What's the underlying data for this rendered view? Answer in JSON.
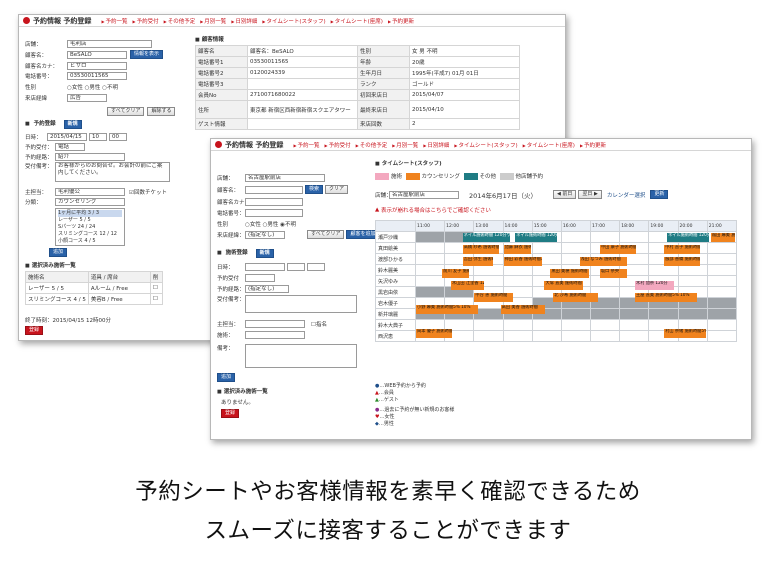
{
  "back": {
    "title": "予約情報 予約登録",
    "nav": [
      "予約一覧",
      "予約受付",
      "その他予定",
      "月別一覧",
      "日別詳細",
      "タイムシート(スタッフ)",
      "タイムシート(座席)",
      "予約更新"
    ],
    "search_section": "お客様検索",
    "member_label": "店舗：",
    "member_value": "毛利店",
    "name_label": "顧客名：",
    "name_value": "BeSALO",
    "kana_label": "顧客名カナ：",
    "kana_value": "ビサロ",
    "tel_label": "電話番号：",
    "tel_value": "03530011565",
    "gender_label": "性別",
    "gender_options": [
      "女性",
      "男性",
      "不明"
    ],
    "source_label": "来店経緯",
    "source_value": "広告",
    "clear_btn": "すべてクリア",
    "search_btn": "情報を表示",
    "cancel_btn": "解除する",
    "reserve_section": "予約登録",
    "new_btn": "新規",
    "date_label": "日時：",
    "date_value": "2015/04/15",
    "hour_value": "10",
    "min_value": "00",
    "status_label": "予約受付：",
    "status_value": "電話",
    "route_label": "予約経路：",
    "route_value": "紹介",
    "memo_label": "受付備考：",
    "memo_value": "お客様からのお問合せ。お会計の前にご案内してください。",
    "staff_label": "主担当：",
    "staff_value": "毛利優公",
    "ticket_label": "回数チケット",
    "menu_label": "分類：",
    "menu_value": "カウンセリング",
    "menu_list": [
      "1ヶ月に平均 3 / 3",
      "レーザー 5 / 5",
      "Sパーツ 24 / 24",
      "スリミングコース 12 / 12",
      "小顔コース 4 / 5"
    ],
    "add_btn": "追加",
    "selected_section": "選択済み施術一覧",
    "selected_head": [
      "施術名",
      "道具 / 席台",
      "削"
    ],
    "selected_rows": [
      {
        "name": "レーザー 5 / 5",
        "tool": "Aルーム",
        "seat": "Free"
      },
      {
        "name": "スリミングコース 4 / 5",
        "tool": "美容B",
        "seat": "Free"
      }
    ],
    "updated": "終了時刻：2015/04/15 12時00分",
    "register_btn": "登録",
    "info_section": "顧客情報",
    "info_rows": [
      {
        "k": "顧客名",
        "v": "顧客名：BeSALO",
        "k2": "性別",
        "v2": "女  男  不明"
      },
      {
        "k": "電話番号1",
        "v": "03530011565",
        "k2": "年齢",
        "v2": "20歳"
      },
      {
        "k": "電話番号2",
        "v": "0120024339",
        "k2": "生年月日",
        "v2": "1995年(平成7)  01月  01日"
      },
      {
        "k": "電話番号3",
        "v": "",
        "k2": "ランク",
        "v2": "ゴールド"
      },
      {
        "k": "会員No",
        "v": "2710071680022",
        "k2": "初回来店日",
        "v2": "2015/04/07"
      },
      {
        "k": "住所",
        "v": "東京都  新宿区西新宿新宿スクエアタワー",
        "k2": "最終来店日",
        "v2": "2015/04/10"
      },
      {
        "k": "ゲスト情報",
        "v": "",
        "k2": "来店回数",
        "v2": "2"
      }
    ]
  },
  "front": {
    "title": "予約情報 予約登録",
    "nav": [
      "予約一覧",
      "予約受付",
      "その他予定",
      "月別一覧",
      "日別詳細",
      "タイムシート(スタッフ)",
      "タイムシート(座席)",
      "予約更新"
    ],
    "store_label": "店舗：",
    "store_value": "名古屋駅前店",
    "name_label": "顧客名：",
    "kana_label": "顧客名カナ：",
    "tel_label": "電話番号：",
    "gender_label": "性別",
    "gender_options": [
      "女性",
      "男性",
      "不明"
    ],
    "source_label": "来店経緯：",
    "source_value": "(指定なし)",
    "search_btn": "検索",
    "clear_btn": "クリア",
    "all_clear_btn": "すべてクリア",
    "new_customer_btn": "顧客を追加",
    "reserve_section": "施術登録",
    "new_btn": "新規",
    "date_label": "日時：",
    "menu_section_label": "予約受付",
    "route_label": "予約経路：",
    "route_value": "(指定なし)",
    "memo_label": "受付備考：",
    "staff_label": "主担当：",
    "assign_label": "指名",
    "menu_label": "施術：",
    "note_label": "備考：",
    "add_btn": "追加",
    "selected_section": "選択済み施術一覧",
    "selected_empty": "ありません。",
    "register_btn": "登録",
    "timesheet_section": "タイムシート(スタッフ)",
    "legend": [
      {
        "label": "施術",
        "color": "#f3a8bf"
      },
      {
        "label": "カウンセリング",
        "color": "#f0831e"
      },
      {
        "label": "その他",
        "color": "#1f7c84"
      },
      {
        "label": "他店舗予約",
        "color": "#cccccc"
      }
    ],
    "store2_label": "店舗：",
    "store2_value": "名古屋駅前店",
    "date_display": "2014年6月17日（火）",
    "prev_btn": "前日",
    "next_btn": "翌日",
    "calendar_label": "カレンダー選択",
    "update_btn": "更新",
    "warning": "表示が崩れる場合はこちらでご確認ください",
    "hours": [
      "11:00",
      "12:00",
      "13:00",
      "14:00",
      "15:00",
      "16:00",
      "17:00",
      "18:00",
      "19:00",
      "20:00",
      "21:00"
    ],
    "staff": [
      "瀬戸沙織",
      "真田絵美",
      "渡部ひかる",
      "鈴木麗美",
      "矢沢ゆみ",
      "黒岩由依",
      "岩木優子",
      "新井璃麗",
      "鈴木大典子",
      "西沢恵"
    ],
    "appointments": [
      {
        "row": 0,
        "start": 1.6,
        "len": 1.7,
        "color": "teal",
        "text": "ネイル施術時間 120分ワックスリフトアップ"
      },
      {
        "row": 0,
        "start": 3.4,
        "len": 1.5,
        "color": "teal",
        "text": "ネイル施術時間 120分ワックスリフトアップ"
      },
      {
        "row": 0,
        "start": 8.6,
        "len": 1.5,
        "color": "teal",
        "text": "ネイル施術時間 120分"
      },
      {
        "row": 0,
        "start": 10.1,
        "len": 0.9,
        "color": "orange",
        "text": "福田 麻美 施術時間5%"
      },
      {
        "row": 1,
        "start": 1.6,
        "len": 1.3,
        "color": "orange",
        "text": "高橋 紗希 施術時間60分"
      },
      {
        "row": 1,
        "start": 3.0,
        "len": 1.0,
        "color": "orange",
        "text": "加藤 麻衣 施術時間"
      },
      {
        "row": 1,
        "start": 6.3,
        "len": 1.3,
        "color": "orange",
        "text": "中田 康子 施術時間"
      },
      {
        "row": 1,
        "start": 8.5,
        "len": 1.3,
        "color": "orange",
        "text": "中村 直子 施術時間"
      },
      {
        "row": 2,
        "start": 1.6,
        "len": 1.1,
        "color": "orange",
        "text": "吉田 弥生 施術時間"
      },
      {
        "row": 2,
        "start": 3.0,
        "len": 1.4,
        "color": "orange",
        "text": "神田 彩香 施術時間3%"
      },
      {
        "row": 2,
        "start": 5.6,
        "len": 1.7,
        "color": "orange",
        "text": "浅田 なつみ 施術時間"
      },
      {
        "row": 2,
        "start": 8.5,
        "len": 1.3,
        "color": "orange",
        "text": "服部 香織 施術時間"
      },
      {
        "row": 3,
        "start": 0.9,
        "len": 1.0,
        "color": "orange",
        "text": "前川 友子 施術時間"
      },
      {
        "row": 3,
        "start": 4.6,
        "len": 1.4,
        "color": "orange",
        "text": "黒田 美穂 施術時間"
      },
      {
        "row": 3,
        "start": 6.3,
        "len": 1.0,
        "color": "orange",
        "text": "坂口 奈央"
      },
      {
        "row": 4,
        "start": 1.2,
        "len": 1.2,
        "color": "orange",
        "text": "木山田 江里香 120分"
      },
      {
        "row": 4,
        "start": 4.4,
        "len": 1.4,
        "color": "orange",
        "text": "大塚 直美 施術時間"
      },
      {
        "row": 4,
        "start": 7.5,
        "len": 1.4,
        "color": "pink",
        "text": "木村 加奈 120分"
      },
      {
        "row": 5,
        "start": 2.0,
        "len": 1.4,
        "color": "orange",
        "text": "中谷 恵 施術時間"
      },
      {
        "row": 5,
        "start": 4.7,
        "len": 1.6,
        "color": "orange",
        "text": "北 沙希 施術時間"
      },
      {
        "row": 5,
        "start": 7.5,
        "len": 2.2,
        "color": "orange",
        "text": "土屋 直美 施術時間5% 10%"
      },
      {
        "row": 6,
        "start": 0.0,
        "len": 2.2,
        "color": "orange",
        "text": "小野 麻美 施術時間5% 10%"
      },
      {
        "row": 6,
        "start": 2.9,
        "len": 1.6,
        "color": "orange",
        "text": "高田 美香 施術時間"
      },
      {
        "row": 8,
        "start": 0.0,
        "len": 1.3,
        "color": "orange",
        "text": "岡本 優子 施術時間1.5h"
      },
      {
        "row": 8,
        "start": 8.5,
        "len": 1.5,
        "color": "orange",
        "text": "村山 奈緒 施術時間5%"
      }
    ],
    "closed": [
      {
        "row": 0,
        "from": 0,
        "to": 1.6
      },
      {
        "row": 5,
        "from": 0,
        "to": 2.0
      },
      {
        "row": 6,
        "from": 4.5,
        "to": 11
      },
      {
        "row": 7,
        "from": 0,
        "to": 11
      },
      {
        "row": 9,
        "from": 0,
        "to": 0.0
      }
    ],
    "notes": [
      "…WEB予約から予約",
      "…会員",
      "…ゲスト",
      "…過去に予約が無い新規のお客様",
      "…女性",
      "…男性"
    ]
  },
  "caption": [
    "予約シートやお客様情報を素早く確認できるため",
    "スムーズに接客することができます"
  ]
}
